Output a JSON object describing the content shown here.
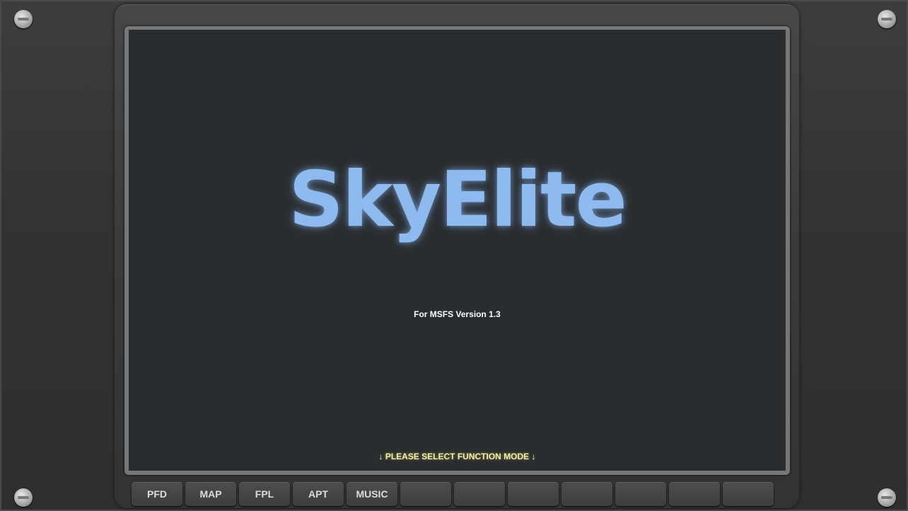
{
  "display": {
    "logo": "SkyElite",
    "version_text": "For MSFS Version 1.3",
    "prompt_text": "↓ PLEASE SELECT FUNCTION MODE ↓"
  },
  "softkeys": [
    "PFD",
    "MAP",
    "FPL",
    "APT",
    "MUSIC",
    "",
    "",
    "",
    "",
    "",
    "",
    ""
  ],
  "colors": {
    "logo": "#8fbaf0",
    "prompt": "#f3f0a6",
    "screen_background": "#2a2d2f"
  }
}
